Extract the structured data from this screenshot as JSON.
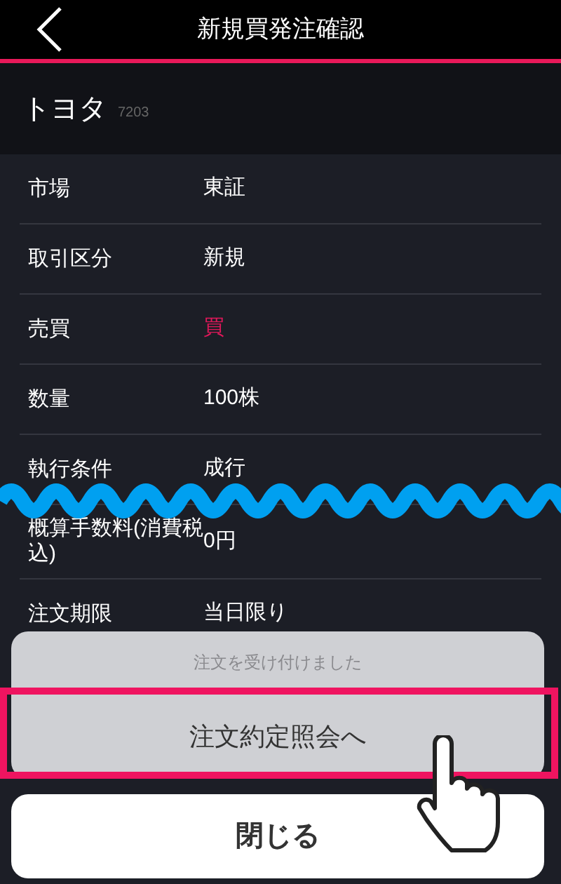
{
  "header": {
    "title": "新規買発注確認"
  },
  "stock": {
    "name": "トヨタ",
    "code": "7203"
  },
  "rows": [
    {
      "label": "市場",
      "value": "東証"
    },
    {
      "label": "取引区分",
      "value": "新規"
    },
    {
      "label": "売買",
      "value": "買",
      "color": "#e0185a"
    },
    {
      "label": "数量",
      "value": "100株"
    },
    {
      "label": "執行条件",
      "value": "成行"
    },
    {
      "label": "概算手数料(消費税込)",
      "value": "0円"
    },
    {
      "label": "注文期限",
      "value": "当日限り"
    }
  ],
  "sheet": {
    "message": "注文を受け付けました",
    "action": "注文約定照会へ",
    "close": "閉じる"
  }
}
